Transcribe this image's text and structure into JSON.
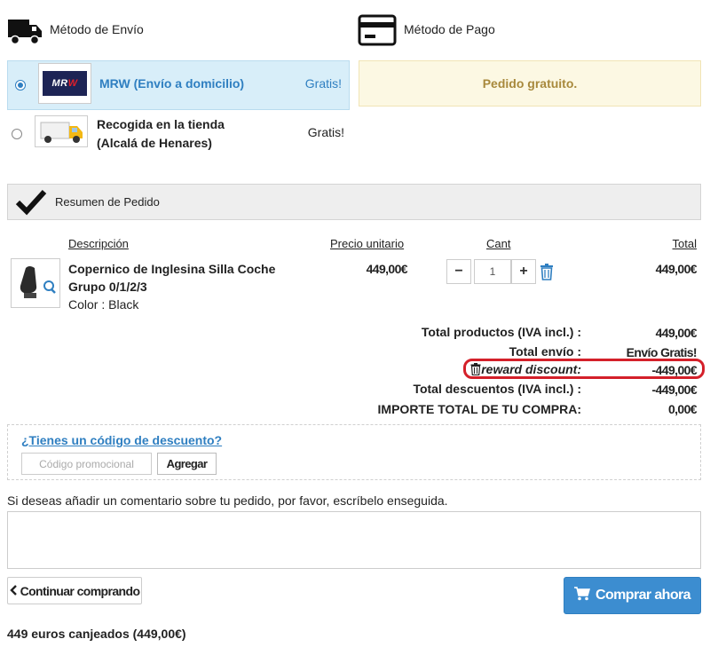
{
  "shipping": {
    "header": "Método de Envío",
    "icon": "truck-icon",
    "options": [
      {
        "title": "MRW (Envío a domicilio)",
        "price": "Gratis!",
        "logo_text_a": "MR",
        "logo_text_b": "W",
        "selected": true
      },
      {
        "title_line1": "Recogida en la tienda",
        "title_line2": "(Alcalá de Henares)",
        "price": "Gratis!",
        "selected": false
      }
    ]
  },
  "payment": {
    "header": "Método de Pago",
    "icon": "credit-card-icon",
    "notice": "Pedido gratuito."
  },
  "summary": {
    "header": "Resumen de Pedido",
    "icon": "checkmark-icon",
    "columns": {
      "description": "Descripción",
      "unit_price": "Precio unitario",
      "qty": "Cant",
      "total": "Total"
    },
    "item": {
      "name": "Copernico de Inglesina Silla Coche Grupo 0/1/2/3",
      "color": "Color : Black",
      "unit_price": "449,00€",
      "qty": "1",
      "minus": "−",
      "plus": "+",
      "total": "449,00€"
    },
    "totals": [
      {
        "label": "Total productos  (IVA incl.) :",
        "value": "449,00€"
      },
      {
        "label": "Total envío :",
        "value": "Envío Gratis!"
      },
      {
        "label": "reward discount:",
        "value": "-449,00€"
      },
      {
        "label": "Total descuentos  (IVA incl.) :",
        "value": "-449,00€"
      },
      {
        "label": "IMPORTE TOTAL DE TU COMPRA:",
        "value": "0,00€"
      }
    ]
  },
  "coupon": {
    "link": "¿Tienes un código de descuento?",
    "placeholder": "Código promocional",
    "button": "Agregar"
  },
  "comment": {
    "label": "Si deseas añadir un comentario sobre tu pedido, por favor, escríbelo enseguida."
  },
  "actions": {
    "continue": "Continuar comprando",
    "buy": "Comprar ahora"
  },
  "footer": {
    "redeemed": "449 euros canjeados (449,00€)"
  },
  "colors": {
    "accent": "#2f7fc1",
    "selected_bg": "#d8eef9",
    "notice_bg": "#fcf8e3",
    "notice_text": "#a8893c",
    "highlight": "#d4202a",
    "buy_button": "#3c8dd0"
  }
}
